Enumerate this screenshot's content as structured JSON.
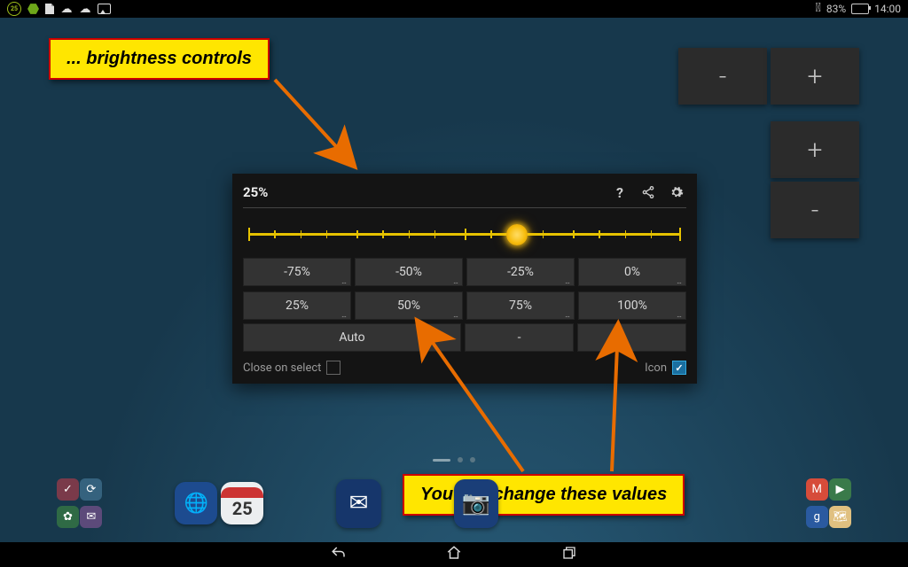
{
  "status": {
    "battery_pct": "83%",
    "clock": "14:00",
    "badge25": "25"
  },
  "widget_buttons": {
    "minus1": "-",
    "plus1": "+",
    "plus2": "+",
    "minus2": "-"
  },
  "panel": {
    "current": "25%",
    "slider_pos_pct": 62,
    "presets_row1": [
      "-75%",
      "-50%",
      "-25%",
      "0%"
    ],
    "presets_row2": [
      "25%",
      "50%",
      "75%",
      "100%"
    ],
    "row3": {
      "auto": "Auto",
      "dash": "-",
      "blank": ""
    },
    "close_label": "Close on select",
    "icon_label": "Icon",
    "icon_checked": true
  },
  "callouts": {
    "top": "... brightness controls",
    "bottom": "You can change these values"
  },
  "dock": {
    "calendar_day": "25"
  }
}
